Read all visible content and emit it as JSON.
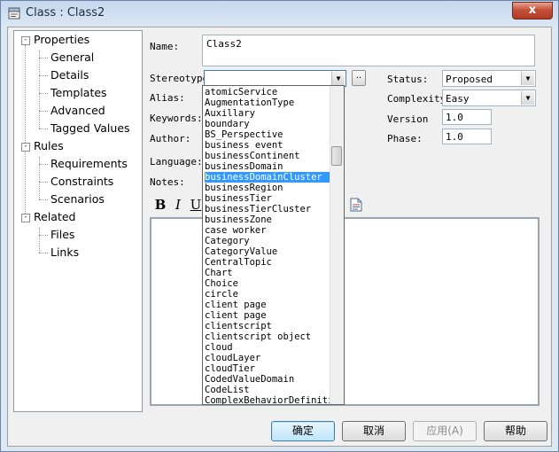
{
  "window": {
    "title": "Class : Class2",
    "close_label": "x"
  },
  "tree": {
    "nodes": [
      {
        "label": "Properties",
        "expander": "-"
      },
      {
        "label": "General"
      },
      {
        "label": "Details"
      },
      {
        "label": "Templates"
      },
      {
        "label": "Advanced"
      },
      {
        "label": "Tagged Values"
      },
      {
        "label": "Rules",
        "expander": "-"
      },
      {
        "label": "Requirements"
      },
      {
        "label": "Constraints"
      },
      {
        "label": "Scenarios"
      },
      {
        "label": "Related",
        "expander": "-"
      },
      {
        "label": "Files"
      },
      {
        "label": "Links"
      }
    ]
  },
  "form": {
    "name_label": "Name:",
    "name_value": "Class2",
    "stereotype_label": "Stereotype",
    "stereotype_value": "",
    "stereotype_more": "..",
    "alias_label": "Alias:",
    "keywords_label": "Keywords:",
    "author_label": "Author:",
    "language_label": "Language:",
    "notes_label": "Notes:",
    "status_label": "Status:",
    "status_value": "Proposed",
    "complexity_label": "Complexity",
    "complexity_value": "Easy",
    "version_label": "Version",
    "version_value": "1.0",
    "phase_label": "Phase:",
    "phase_value": "1.0"
  },
  "toolbar": {
    "bold": "B",
    "italic": "I",
    "underline": "U"
  },
  "stereotype_options": [
    "atomicService",
    "AugmentationType",
    "Auxillary",
    "boundary",
    "BS_Perspective",
    "business event",
    "businessContinent",
    "businessDomain",
    "businessDomainCluster",
    "businessRegion",
    "businessTier",
    "businessTierCluster",
    "businessZone",
    "case worker",
    "Category",
    "CategoryValue",
    "CentralTopic",
    "Chart",
    "Choice",
    "circle",
    "client page",
    "client page",
    "clientscript",
    "clientscript object",
    "cloud",
    "cloudLayer",
    "cloudTier",
    "CodedValueDomain",
    "CodeList",
    "ComplexBehaviorDefinition"
  ],
  "selected_index": 8,
  "buttons": {
    "ok": "确定",
    "cancel": "取消",
    "apply": "应用(A)",
    "help": "帮助"
  }
}
